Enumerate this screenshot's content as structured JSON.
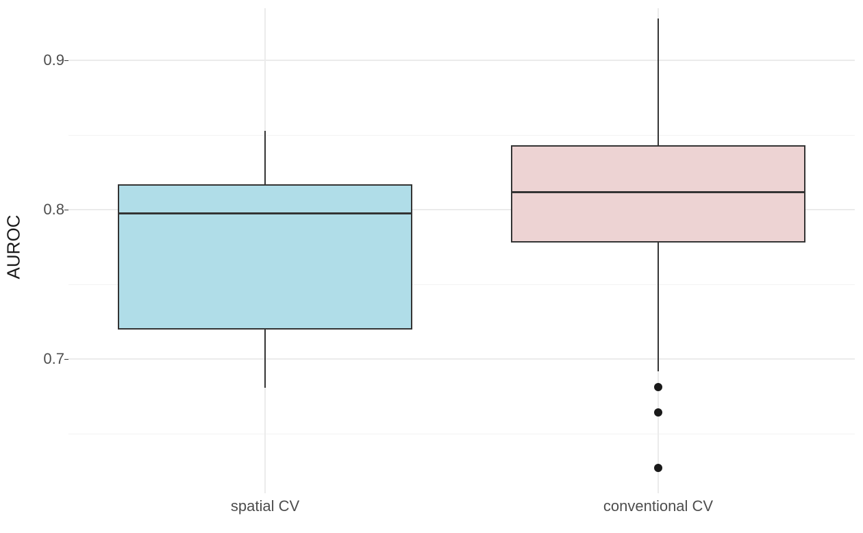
{
  "chart_data": {
    "type": "boxplot",
    "ylabel": "AUROC",
    "ylim": [
      0.61,
      0.935
    ],
    "yticks": [
      0.7,
      0.8,
      0.9
    ],
    "categories": [
      "spatial CV",
      "conventional CV"
    ],
    "series": [
      {
        "name": "spatial CV",
        "color": "#B0DDE8",
        "min": 0.681,
        "q1": 0.72,
        "median": 0.798,
        "q3": 0.817,
        "max": 0.853,
        "outliers": []
      },
      {
        "name": "conventional CV",
        "color": "#EDD3D3",
        "min": 0.681,
        "q1": 0.778,
        "median": 0.812,
        "q3": 0.843,
        "max": 0.928,
        "outliers": [
          0.681,
          0.664,
          0.627
        ]
      }
    ]
  },
  "ylabel_text": "AUROC",
  "ytick_labels": {
    "t07": "0.7",
    "t08": "0.8",
    "t09": "0.9"
  },
  "xtick_labels": {
    "c0": "spatial CV",
    "c1": "conventional CV"
  }
}
